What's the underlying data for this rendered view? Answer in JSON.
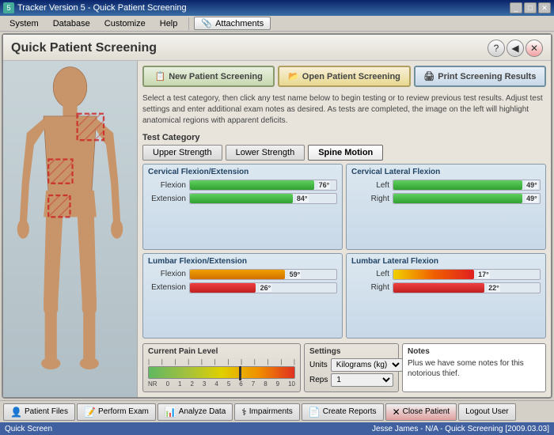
{
  "window": {
    "title": "Tracker Version 5 - Quick Patient Screening"
  },
  "menu": {
    "items": [
      "System",
      "Database",
      "Customize",
      "Help"
    ],
    "attachments_label": "Attachments"
  },
  "header": {
    "title": "Quick Patient Screening",
    "help_icon": "?",
    "back_icon": "◀",
    "close_icon": "✕"
  },
  "top_buttons": {
    "new_label": "New Patient Screening",
    "open_label": "Open Patient Screening",
    "print_label": "Print Screening Results"
  },
  "instruction": "Select a test category, then click any test name below to begin testing or to review previous test results. Adjust test settings and enter additional exam notes as desired. As tests are completed, the image on the left will highlight anatomical regions with apparent deficits.",
  "test_category": {
    "label": "Test Category",
    "buttons": [
      "Upper Strength",
      "Lower Strength",
      "Spine Motion"
    ],
    "active": "Spine Motion"
  },
  "results": {
    "cervical_flex_ext": {
      "title": "Cervical Flexion/Extension",
      "flexion_label": "Flexion",
      "flexion_value": "76°",
      "flexion_pct": 85,
      "extension_label": "Extension",
      "extension_value": "84°",
      "extension_pct": 70
    },
    "cervical_lat": {
      "title": "Cervical Lateral Flexion",
      "left_label": "Left",
      "left_value": "49°",
      "left_pct": 88,
      "right_label": "Right",
      "right_value": "49°",
      "right_pct": 88
    },
    "lumbar_flex_ext": {
      "title": "Lumbar Flexion/Extension",
      "flexion_label": "Flexion",
      "flexion_value": "59°",
      "flexion_pct": 65,
      "extension_label": "Extension",
      "extension_value": "26°",
      "extension_pct": 50
    },
    "lumbar_lat": {
      "title": "Lumbar Lateral Flexion",
      "left_label": "Left",
      "left_value": "17°",
      "left_pct": 55,
      "right_label": "Right",
      "right_value": "22°",
      "right_pct": 62
    }
  },
  "pain": {
    "title": "Current Pain Level",
    "labels": [
      "NR",
      "0",
      "1",
      "2",
      "3",
      "4",
      "5",
      "6",
      "7",
      "8",
      "9",
      "10"
    ],
    "marker_pct": 62
  },
  "settings": {
    "title": "Settings",
    "units_label": "Units",
    "units_value": "Kilograms (kg)",
    "reps_label": "Reps",
    "reps_value": "1"
  },
  "notes": {
    "title": "Notes",
    "text": "Plus we have some notes for this notorious thief."
  },
  "statusbar": {
    "patient_files": "Patient Files",
    "perform_exam": "Perform Exam",
    "analyze_data": "Analyze Data",
    "impairments": "Impairments",
    "create_reports": "Create Reports",
    "close_patient": "Close Patient",
    "logout": "Logout User",
    "bottom_left": "Quick Screen",
    "bottom_right": "Jesse James - N/A - Quick Screening [2009.03.03]"
  }
}
